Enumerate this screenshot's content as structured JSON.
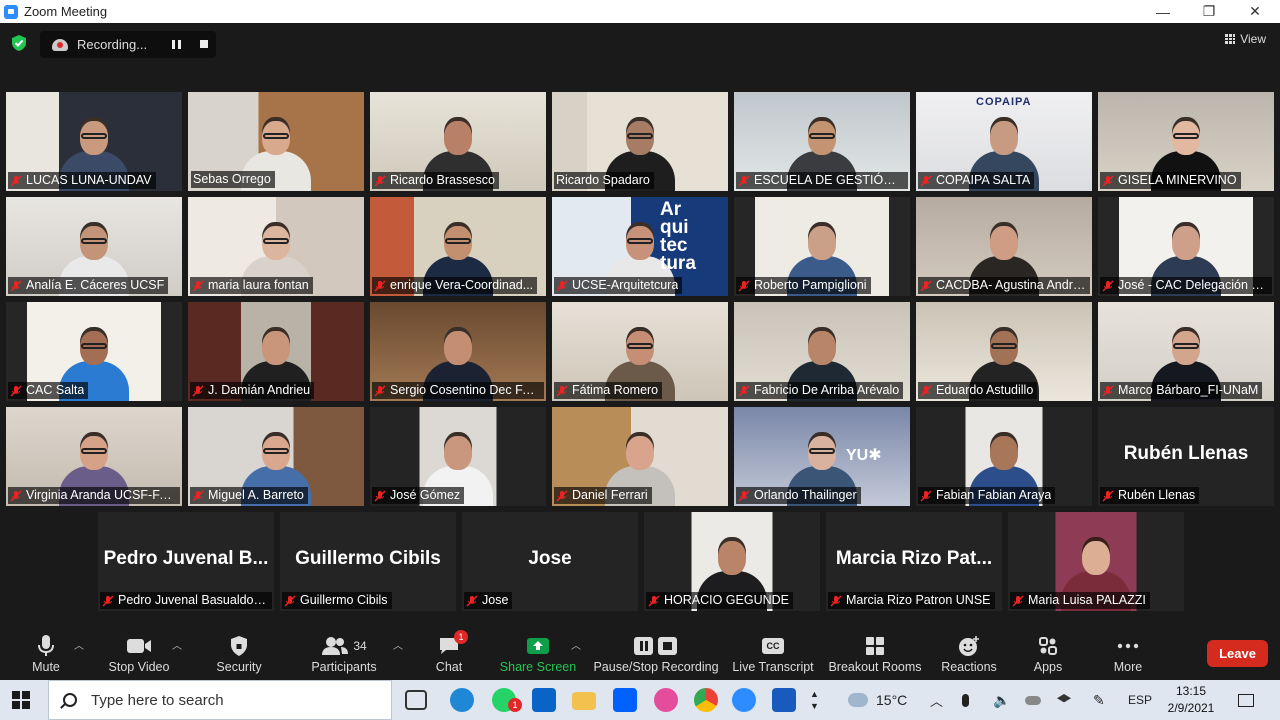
{
  "window": {
    "title": "Zoom Meeting",
    "minimize": "—",
    "restore": "❐",
    "close": "✕"
  },
  "topbar": {
    "recording_label": "Recording...",
    "view_label": "View"
  },
  "tiles": [
    {
      "name": "LUCAS LUNA-UNDAV"
    },
    {
      "name": "Sebas Orrego"
    },
    {
      "name": "Ricardo Brassesco"
    },
    {
      "name": "Ricardo Spadaro"
    },
    {
      "name": "ESCUELA DE GESTIÓN DE..."
    },
    {
      "name": "COPAIPA SALTA"
    },
    {
      "name": "GISELA MINERVINO"
    },
    {
      "name": "Analía E. Cáceres UCSF"
    },
    {
      "name": "maria laura fontan"
    },
    {
      "name": "enrique Vera-Coordinad..."
    },
    {
      "name": "UCSE-Arquitetcura"
    },
    {
      "name": "Roberto Pampiglioni"
    },
    {
      "name": "CACDBA- Agustina Andre..."
    },
    {
      "name": "José - CAC Delegación Ci..."
    },
    {
      "name": "CAC Salta"
    },
    {
      "name": "J. Damián Andrieu"
    },
    {
      "name": "Sergio Cosentino Dec FA..."
    },
    {
      "name": "Fátima Romero"
    },
    {
      "name": "Fabricio De Arriba Arévalo"
    },
    {
      "name": "Eduardo Astudillo"
    },
    {
      "name": "Marco Bárbaro_FI-UNaM"
    },
    {
      "name": "Virginia Aranda UCSF-FAD"
    },
    {
      "name": "Miguel A. Barreto"
    },
    {
      "name": "José Gómez"
    },
    {
      "name": "Daniel Ferrari"
    },
    {
      "name": "Orlando Thailinger"
    },
    {
      "name": "Fabian Fabian Araya"
    },
    {
      "name": "Rubén Llenas",
      "big": "Rubén Llenas"
    },
    {
      "name": "Pedro Juvenal Basualdo- ...",
      "big": "Pedro Juvenal B..."
    },
    {
      "name": "Guillermo Cibils",
      "big": "Guillermo Cibils"
    },
    {
      "name": "Jose",
      "big": "Jose"
    },
    {
      "name": "HORACIO GEGUNDE"
    },
    {
      "name": "Marcia Rizo Patron UNSE",
      "big": "Marcia Rizo Pat..."
    },
    {
      "name": "Maria Luisa PALAZZI"
    }
  ],
  "tile_logos": {
    "copaipa": "COPAIPA",
    "ucse_sign": "Ar\nqui\ntec\ntura",
    "orlando_logo": "YU✱"
  },
  "toolbar": {
    "mute": "Mute",
    "stop_video": "Stop Video",
    "security": "Security",
    "participants": "Participants",
    "participants_count": "34",
    "chat": "Chat",
    "chat_badge": "1",
    "share_screen": "Share Screen",
    "pause_stop_recording": "Pause/Stop Recording",
    "live_transcript": "Live Transcript",
    "live_transcript_icon": "CC",
    "breakout_rooms": "Breakout Rooms",
    "reactions": "Reactions",
    "apps": "Apps",
    "more": "More",
    "leave": "Leave"
  },
  "taskbar": {
    "search_placeholder": "Type here to search",
    "whatsapp_badge": "1",
    "temperature": "15°C",
    "language": "ESP",
    "time": "13:15",
    "date": "2/9/2021"
  },
  "colors": {
    "accent_green": "#23c552",
    "leave_red": "#d52b1e",
    "active_speaker": "#c8e04a",
    "share_green": "#0e9f4a"
  }
}
